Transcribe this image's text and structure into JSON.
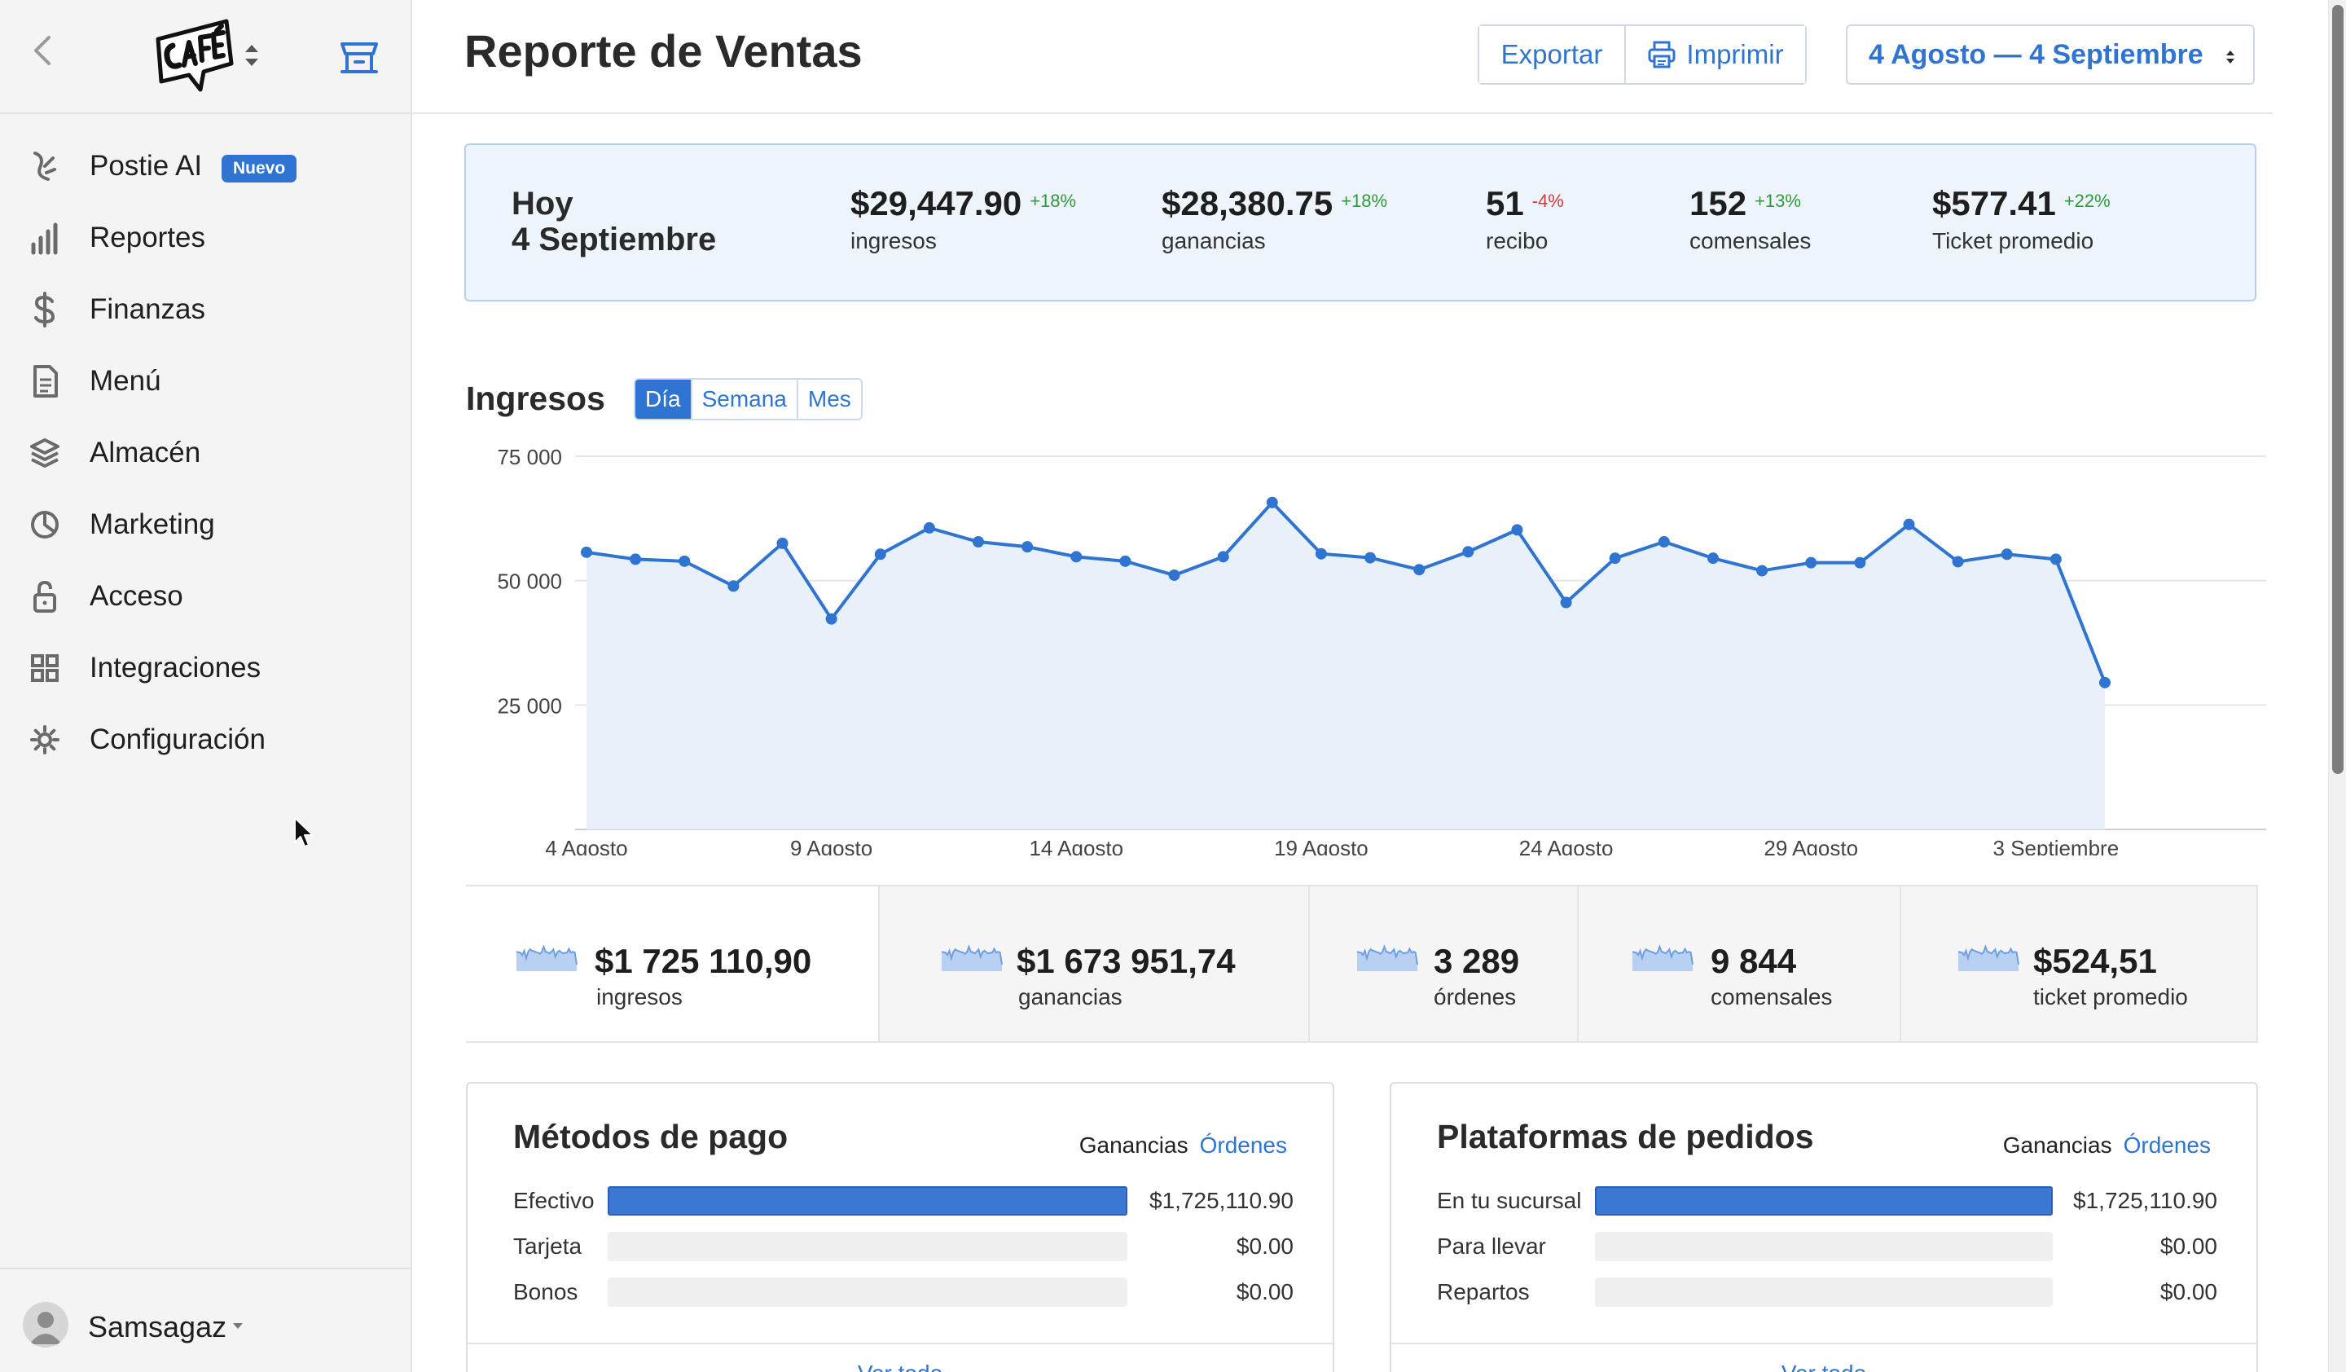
{
  "sidebar": {
    "items": [
      {
        "label": "Postie AI",
        "icon": "ai-icon",
        "badge": "Nuevo"
      },
      {
        "label": "Reportes",
        "icon": "bar-chart-icon"
      },
      {
        "label": "Finanzas",
        "icon": "dollar-icon"
      },
      {
        "label": "Menú",
        "icon": "document-icon"
      },
      {
        "label": "Almacén",
        "icon": "layers-icon"
      },
      {
        "label": "Marketing",
        "icon": "pie-icon"
      },
      {
        "label": "Acceso",
        "icon": "lock-icon"
      },
      {
        "label": "Integraciones",
        "icon": "grid-icon"
      },
      {
        "label": "Configuración",
        "icon": "gear-icon"
      }
    ],
    "user": {
      "name": "Samsagaz"
    }
  },
  "header": {
    "title": "Reporte de Ventas",
    "export_label": "Exportar",
    "print_label": "Imprimir",
    "date_range": "4 Agosto — 4 Septiembre"
  },
  "today": {
    "label_line1": "Hoy",
    "label_line2": "4 Septiembre",
    "kpis": [
      {
        "value": "$29,447.90",
        "delta": "+18%",
        "trend": "up",
        "label": "ingresos"
      },
      {
        "value": "$28,380.75",
        "delta": "+18%",
        "trend": "up",
        "label": "ganancias"
      },
      {
        "value": "51",
        "delta": "-4%",
        "trend": "down",
        "label": "recibo"
      },
      {
        "value": "152",
        "delta": "+13%",
        "trend": "up",
        "label": "comensales"
      },
      {
        "value": "$577.41",
        "delta": "+22%",
        "trend": "up",
        "label": "Ticket promedio"
      }
    ]
  },
  "ingresos": {
    "title": "Ingresos",
    "periods": [
      "Día",
      "Semana",
      "Mes"
    ],
    "active_period": "Día"
  },
  "chart_data": {
    "type": "area",
    "title": "Ingresos",
    "xlabel": "",
    "ylabel": "",
    "ylim": [
      0,
      75000
    ],
    "yticks": [
      25000,
      50000,
      75000
    ],
    "ytick_labels": [
      "25 000",
      "50 000",
      "75 000"
    ],
    "xtick_labels": [
      "4 Agosto",
      "9 Agosto",
      "14 Agosto",
      "19 Agosto",
      "24 Agosto",
      "29 Agosto",
      "3 Septiembre"
    ],
    "xtick_index": [
      0,
      5,
      10,
      15,
      20,
      25,
      30
    ],
    "grid": true,
    "x": [
      "4 Ago",
      "5 Ago",
      "6 Ago",
      "7 Ago",
      "8 Ago",
      "9 Ago",
      "10 Ago",
      "11 Ago",
      "12 Ago",
      "13 Ago",
      "14 Ago",
      "15 Ago",
      "16 Ago",
      "17 Ago",
      "18 Ago",
      "19 Ago",
      "20 Ago",
      "21 Ago",
      "22 Ago",
      "23 Ago",
      "24 Ago",
      "25 Ago",
      "26 Ago",
      "27 Ago",
      "28 Ago",
      "29 Ago",
      "30 Ago",
      "31 Ago",
      "1 Sep",
      "2 Sep",
      "3 Sep",
      "4 Sep"
    ],
    "values": [
      55700,
      54300,
      53900,
      48900,
      57500,
      42300,
      55300,
      60600,
      57800,
      56800,
      54800,
      53900,
      51100,
      54800,
      65700,
      55400,
      54600,
      52200,
      55800,
      60200,
      45600,
      54500,
      57800,
      54500,
      52000,
      53600,
      53600,
      61300,
      53800,
      55300,
      54300,
      29500
    ],
    "color": "#2f74d0",
    "fill": "#e8f0fa"
  },
  "summary": [
    {
      "value": "$1 725 110,90",
      "label": "ingresos"
    },
    {
      "value": "$1 673 951,74",
      "label": "ganancias"
    },
    {
      "value": "3 289",
      "label": "órdenes"
    },
    {
      "value": "9 844",
      "label": "comensales"
    },
    {
      "value": "$524,51",
      "label": "ticket promedio"
    }
  ],
  "payment_methods": {
    "title": "Métodos de pago",
    "toggle_a": "Ganancias",
    "toggle_b": "Órdenes",
    "rows": [
      {
        "label": "Efectivo",
        "value": "$1,725,110.90",
        "fraction": 1.0
      },
      {
        "label": "Tarjeta",
        "value": "$0.00",
        "fraction": 0
      },
      {
        "label": "Bonos",
        "value": "$0.00",
        "fraction": 0
      }
    ],
    "see_all": "Ver todo"
  },
  "order_platforms": {
    "title": "Plataformas de pedidos",
    "toggle_a": "Ganancias",
    "toggle_b": "Órdenes",
    "rows": [
      {
        "label": "En tu sucursal",
        "value": "$1,725,110.90",
        "fraction": 1.0
      },
      {
        "label": "Para llevar",
        "value": "$0.00",
        "fraction": 0
      },
      {
        "label": "Repartos",
        "value": "$0.00",
        "fraction": 0
      }
    ],
    "see_all": "Ver todo"
  }
}
